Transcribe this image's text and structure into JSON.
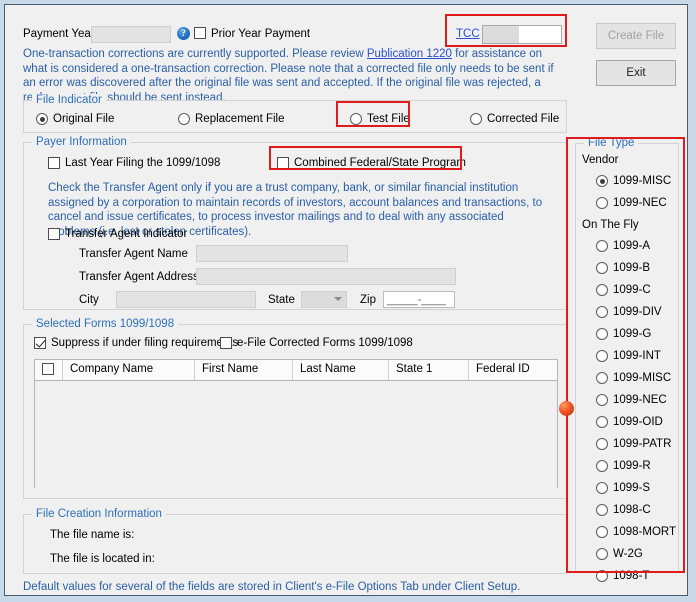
{
  "header": {
    "payment_year_label": "Payment Year",
    "payment_year_value": "",
    "help_icon_glyph": "?",
    "prior_year_label": "Prior Year Payment",
    "prior_year_checked": false,
    "tcc_label": "TCC",
    "tcc_value": "",
    "create_file_label": "Create File",
    "create_file_enabled": false,
    "exit_label": "Exit"
  },
  "notice": {
    "part1": "One-transaction corrections are currently supported. Please review ",
    "link": "Publication 1220",
    "part2": " for assistance on what is considered a one-transaction correction. Please note that a corrected file only needs to be sent if an error was discovered after the original file was sent and accepted. If the original file was rejected, a replacement file should be sent instead."
  },
  "file_indicator": {
    "title": "File Indicator",
    "options": [
      {
        "label": "Original File",
        "selected": true
      },
      {
        "label": "Replacement File",
        "selected": false
      },
      {
        "label": "Test File",
        "selected": false
      },
      {
        "label": "Corrected File",
        "selected": false
      }
    ]
  },
  "payer_information": {
    "title": "Payer Information",
    "last_year_label": "Last Year Filing the 1099/1098",
    "last_year_checked": false,
    "combined_label": "Combined Federal/State Program",
    "combined_checked": false,
    "transfer_agent_note": "Check the Transfer Agent only if you are a trust company, bank, or similar financial institution assigned by a corporation to maintain records of investors, account balances and transactions, to cancel and issue certificates, to process investor mailings and to deal with any associated problems (i.e. lost or stolen certificates).",
    "transfer_agent_indicator_label": "Transfer Agent Indicator",
    "transfer_agent_indicator_checked": false,
    "name_label": "Transfer Agent Name",
    "name_value": "",
    "address_label": "Transfer Agent Address",
    "address_value": "",
    "city_label": "City",
    "city_value": "",
    "state_label": "State",
    "state_value": "",
    "zip_label": "Zip",
    "zip_mask": "_____-____"
  },
  "selected_forms": {
    "title": "Selected Forms 1099/1098",
    "suppress_label": "Suppress if under filing requirements",
    "suppress_checked": true,
    "efile_corrected_label": "e-File Corrected Forms 1099/1098",
    "efile_corrected_checked": false,
    "columns": [
      "Company Name",
      "First Name",
      "Last Name",
      "State 1",
      "Federal ID"
    ],
    "rows": []
  },
  "file_creation": {
    "title": "File Creation Information",
    "file_name_label": "The file name is:",
    "file_name_value": "",
    "file_location_label": "The file is located in:",
    "file_location_value": ""
  },
  "footer": {
    "note": "Default values for several of the fields are stored in Client's e-File Options Tab under Client Setup."
  },
  "file_type": {
    "title": "File Type",
    "vendor_label": "Vendor",
    "vendor_options": [
      {
        "label": "1099-MISC",
        "selected": true
      },
      {
        "label": "1099-NEC",
        "selected": false
      }
    ],
    "on_the_fly_label": "On The Fly",
    "on_the_fly_options": [
      {
        "label": "1099-A",
        "selected": false
      },
      {
        "label": "1099-B",
        "selected": false
      },
      {
        "label": "1099-C",
        "selected": false
      },
      {
        "label": "1099-DIV",
        "selected": false
      },
      {
        "label": "1099-G",
        "selected": false
      },
      {
        "label": "1099-INT",
        "selected": false
      },
      {
        "label": "1099-MISC",
        "selected": false
      },
      {
        "label": "1099-NEC",
        "selected": false
      },
      {
        "label": "1099-OID",
        "selected": false
      },
      {
        "label": "1099-PATR",
        "selected": false
      },
      {
        "label": "1099-R",
        "selected": false
      },
      {
        "label": "1099-S",
        "selected": false
      },
      {
        "label": "1098-C",
        "selected": false
      },
      {
        "label": "1098-MORT",
        "selected": false
      },
      {
        "label": "W-2G",
        "selected": false
      },
      {
        "label": "1098-T",
        "selected": false
      }
    ]
  },
  "annotations": {
    "colors": {
      "highlight": "#e01b1b",
      "marker": "#f05a28",
      "link": "#2a4fd0",
      "info_text": "#2a5fa5",
      "group_title": "#2e6fb7"
    },
    "boxes": [
      "tcc-field",
      "test-file-option",
      "combined-federal-state-checkbox",
      "file-type-panel"
    ],
    "marker_dot": "cursor-marker"
  }
}
